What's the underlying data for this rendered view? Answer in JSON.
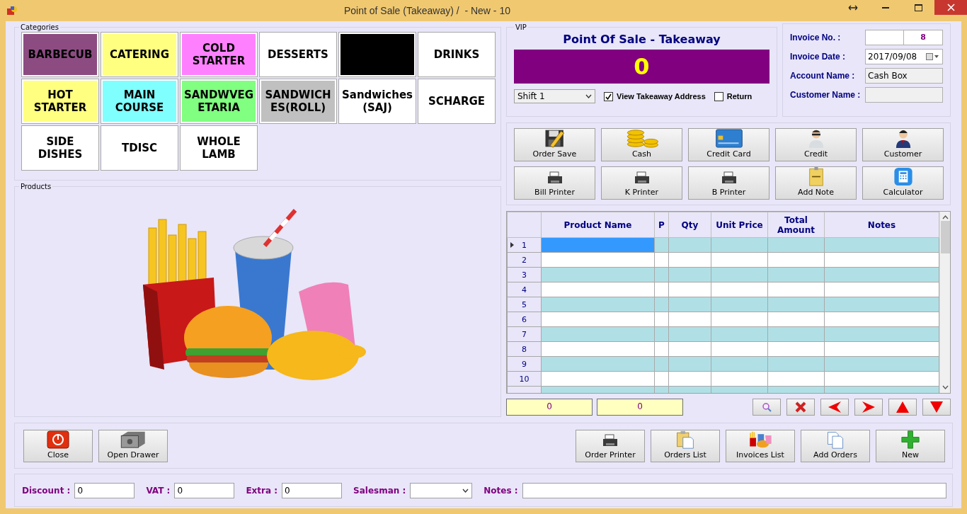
{
  "window": {
    "title": "Point of Sale (Takeaway) /  - New - 10"
  },
  "categories": {
    "legend": "Categories",
    "items": [
      {
        "label": "BARBECUB",
        "color": "#8c4c82"
      },
      {
        "label": "CATERING",
        "color": "#ffff80"
      },
      {
        "label": "COLD STARTER",
        "color": "#ff80ff"
      },
      {
        "label": "DESSERTS",
        "color": "#ffffff"
      },
      {
        "color": "#000000"
      },
      {
        "label": "DRINKS",
        "color": "#ffffff"
      },
      {
        "label": "HOT STARTER",
        "color": "#ffff80"
      },
      {
        "label": "MAIN COURSE",
        "color": "#80ffff"
      },
      {
        "label": "SANDWVEG ETARIA",
        "color": "#80ff80"
      },
      {
        "label": "SANDWICH ES(ROLL)",
        "color": "#c0c0c0"
      },
      {
        "label": "Sandwiches (SAJ)",
        "color": "#ffffff"
      },
      {
        "label": "SCHARGE",
        "color": "#ffffff"
      },
      {
        "label": "SIDE DISHES",
        "color": "#ffffff"
      },
      {
        "label": "TDISC",
        "color": "#ffffff"
      },
      {
        "label": "WHOLE LAMB",
        "color": "#ffffff"
      }
    ]
  },
  "products": {
    "legend": "Products"
  },
  "vip": {
    "legend": "VIP",
    "title": "Point Of Sale - Takeaway",
    "total": "0",
    "shift": "Shift 1",
    "options": [
      {
        "label": "View Takeaway Address",
        "checked": true
      },
      {
        "label": "Return",
        "checked": false
      }
    ]
  },
  "invoice": {
    "fields": [
      {
        "label": "Invoice No. :",
        "kind": "number",
        "value": "8"
      },
      {
        "label": "Invoice Date :",
        "kind": "date",
        "value": "2017/09/08"
      },
      {
        "label": "Account Name :",
        "kind": "readonly",
        "value": "Cash Box"
      },
      {
        "label": "Customer Name :",
        "kind": "readonly"
      }
    ]
  },
  "actions": [
    "Order Save",
    "Cash",
    "Credit Card",
    "Credit",
    "Customer",
    "Bill Printer",
    "K Printer",
    "B Printer",
    "Add Note",
    "Calculator"
  ],
  "table": {
    "columns": [
      "Product Name",
      "P",
      "Qty",
      "Unit Price",
      "Total Amount",
      "Notes"
    ],
    "rows": [
      {
        "number": "1",
        "selected": true
      },
      {
        "number": "2",
        "selected": false
      },
      {
        "number": "3",
        "selected": false
      },
      {
        "number": "4",
        "selected": false
      },
      {
        "number": "5",
        "selected": false
      },
      {
        "number": "6",
        "selected": false
      },
      {
        "number": "7",
        "selected": false
      },
      {
        "number": "8",
        "selected": false
      },
      {
        "number": "9",
        "selected": false
      },
      {
        "number": "10",
        "selected": false
      },
      {
        "selected": false
      }
    ]
  },
  "summary": [
    "0",
    "0"
  ],
  "toolbar_left": [
    "Close",
    "Open Drawer"
  ],
  "toolbar_right": [
    "Order Printer",
    "Orders List",
    "Invoices List",
    "Add Orders",
    "New"
  ],
  "footer": {
    "fields": [
      {
        "label": "Discount :",
        "kind": "text",
        "value": "0"
      },
      {
        "label": "VAT :",
        "kind": "text",
        "value": "0"
      },
      {
        "label": "Extra :",
        "kind": "text",
        "value": "0"
      },
      {
        "label": "Salesman :",
        "kind": "select"
      },
      {
        "label": "Notes :",
        "kind": "wide"
      }
    ]
  }
}
